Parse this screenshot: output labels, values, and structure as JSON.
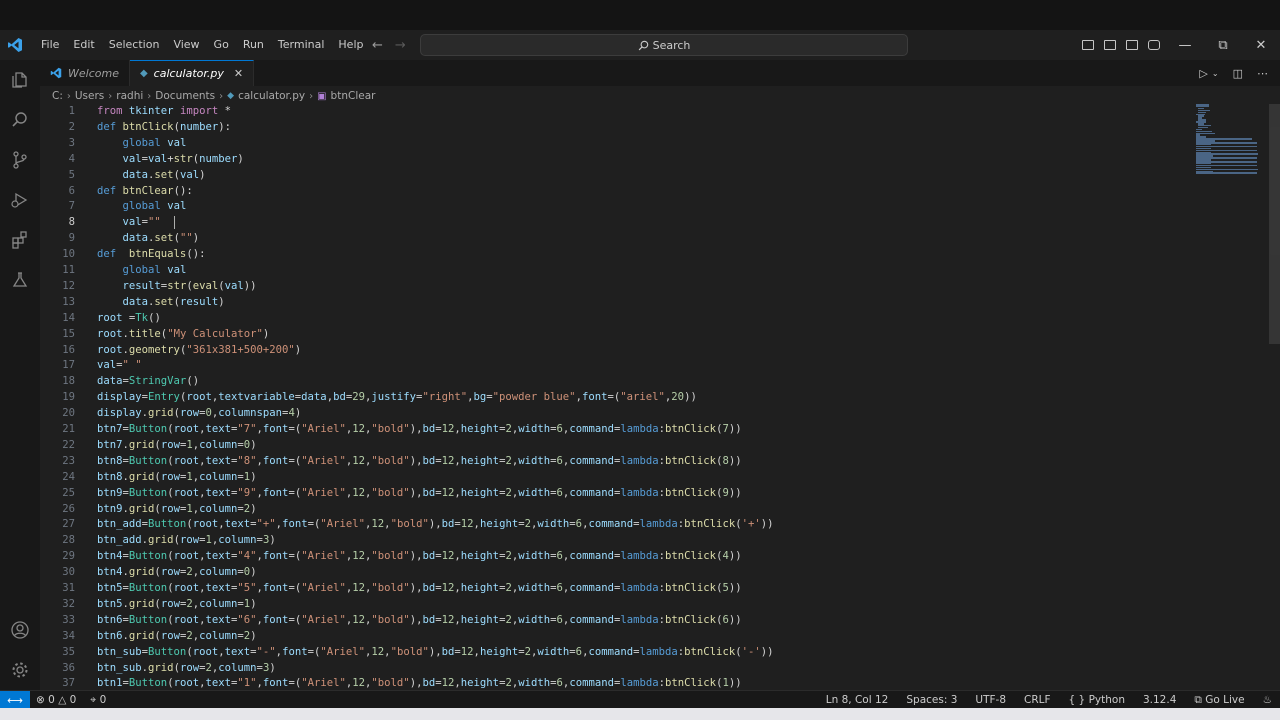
{
  "menu": [
    "File",
    "Edit",
    "Selection",
    "View",
    "Go",
    "Run",
    "Terminal",
    "Help"
  ],
  "search": {
    "label": "Search"
  },
  "tabs": [
    {
      "label": "Welcome",
      "active": false
    },
    {
      "label": "calculator.py",
      "active": true
    }
  ],
  "breadcrumb": [
    "C:",
    "Users",
    "radhi",
    "Documents",
    "calculator.py",
    "btnClear"
  ],
  "editor": {
    "current_line": 8,
    "lines": [
      "from tkinter import *",
      "def btnClick(number):",
      "    global val",
      "    val=val+str(number)",
      "    data.set(val)",
      "def btnClear():",
      "    global val",
      "    val=\"\"  ",
      "    data.set(\"\")",
      "def  btnEquals():",
      "    global val",
      "    result=str(eval(val))",
      "    data.set(result)",
      "root =Tk()",
      "root.title(\"My Calculator\")",
      "root.geometry(\"361x381+500+200\")",
      "val=\" \"",
      "data=StringVar()",
      "display=Entry(root,textvariable=data,bd=29,justify=\"right\",bg=\"powder blue\",font=(\"ariel\",20))",
      "display.grid(row=0,columnspan=4)",
      "btn7=Button(root,text=\"7\",font=(\"Ariel\",12,\"bold\"),bd=12,height=2,width=6,command=lambda:btnClick(7))",
      "btn7.grid(row=1,column=0)",
      "btn8=Button(root,text=\"8\",font=(\"Ariel\",12,\"bold\"),bd=12,height=2,width=6,command=lambda:btnClick(8))",
      "btn8.grid(row=1,column=1)",
      "btn9=Button(root,text=\"9\",font=(\"Ariel\",12,\"bold\"),bd=12,height=2,width=6,command=lambda:btnClick(9))",
      "btn9.grid(row=1,column=2)",
      "btn_add=Button(root,text=\"+\",font=(\"Ariel\",12,\"bold\"),bd=12,height=2,width=6,command=lambda:btnClick('+'))",
      "btn_add.grid(row=1,column=3)",
      "btn4=Button(root,text=\"4\",font=(\"Ariel\",12,\"bold\"),bd=12,height=2,width=6,command=lambda:btnClick(4))",
      "btn4.grid(row=2,column=0)",
      "btn5=Button(root,text=\"5\",font=(\"Ariel\",12,\"bold\"),bd=12,height=2,width=6,command=lambda:btnClick(5))",
      "btn5.grid(row=2,column=1)",
      "btn6=Button(root,text=\"6\",font=(\"Ariel\",12,\"bold\"),bd=12,height=2,width=6,command=lambda:btnClick(6))",
      "btn6.grid(row=2,column=2)",
      "btn_sub=Button(root,text=\"-\",font=(\"Ariel\",12,\"bold\"),bd=12,height=2,width=6,command=lambda:btnClick('-'))",
      "btn_sub.grid(row=2,column=3)",
      "btn1=Button(root,text=\"1\",font=(\"Ariel\",12,\"bold\"),bd=12,height=2,width=6,command=lambda:btnClick(1))"
    ]
  },
  "status": {
    "errors": "0",
    "warnings": "0",
    "ports": "0",
    "position": "Ln 8, Col 12",
    "spaces": "Spaces: 3",
    "encoding": "UTF-8",
    "eol": "CRLF",
    "language": "Python",
    "version": "3.12.4",
    "golive": "Go Live"
  },
  "colors": {
    "accent": "#0078d4",
    "background": "#1f1f1f"
  }
}
